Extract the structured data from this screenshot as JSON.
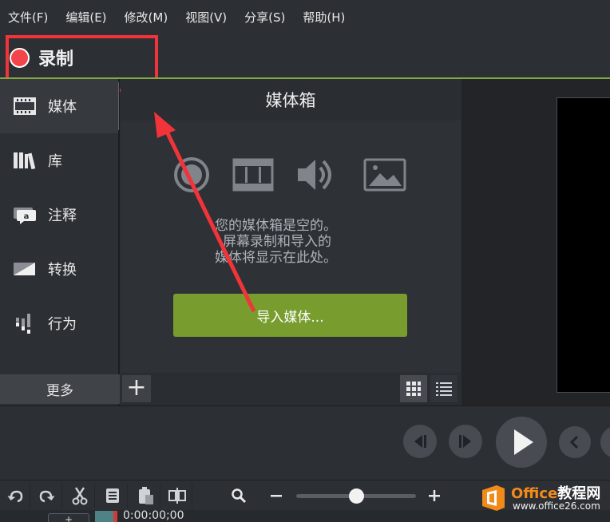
{
  "menu": {
    "items": [
      "文件(F)",
      "编辑(E)",
      "修改(M)",
      "视图(V)",
      "分享(S)",
      "帮助(H)"
    ]
  },
  "record": {
    "label": "录制",
    "dot_color": "#f2444b"
  },
  "sidebar": {
    "items": [
      {
        "label": "媒体",
        "icon": "film-icon"
      },
      {
        "label": "库",
        "icon": "library-icon"
      },
      {
        "label": "注释",
        "icon": "annotation-icon"
      },
      {
        "label": "转换",
        "icon": "transition-icon"
      },
      {
        "label": "行为",
        "icon": "behavior-icon"
      }
    ],
    "more_label": "更多"
  },
  "media_bin": {
    "title": "媒体箱",
    "empty_lines": [
      "您的媒体箱是空的。",
      "屏幕录制和导入的",
      "媒体将显示在此处。"
    ],
    "import_label": "导入媒体...",
    "empty_icons": [
      "record-icon",
      "film-icon",
      "audio-icon",
      "image-icon"
    ],
    "add_label": "+"
  },
  "timeline": {
    "time": "0:00:00;00",
    "add_track_label": "+"
  },
  "watermark": {
    "title_a": "Office",
    "title_b": "教程网",
    "url": "www.office26.com"
  },
  "colors": {
    "accent_green": "#789d2e",
    "highlight_red": "#f1343a",
    "record_red": "#f2444b",
    "watermark_orange": "#f28a1a"
  }
}
